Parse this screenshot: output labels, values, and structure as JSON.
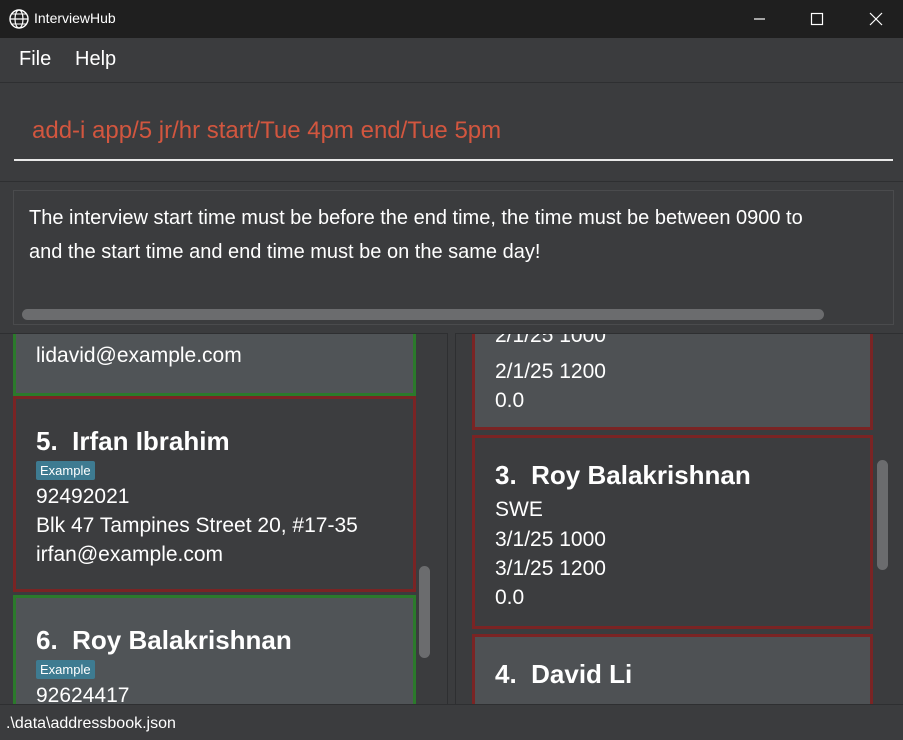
{
  "window": {
    "title": "InterviewHub",
    "icon": "globe-icon"
  },
  "menu": {
    "file": "File",
    "help": "Help"
  },
  "command": {
    "value": "add-i app/5 jr/hr start/Tue 4pm end/Tue 5pm",
    "color": "#d2563f"
  },
  "result": {
    "line1": "The interview start time must be before the end time, the time must be between 0900 to",
    "line2": "and the start time and end time must be on the same day!"
  },
  "applicants": [
    {
      "email": "lidavid@example.com"
    },
    {
      "index": "5.",
      "name": "Irfan Ibrahim",
      "tag": "Example",
      "phone": "92492021",
      "address": "Blk 47 Tampines Street 20, #17-35",
      "email": "irfan@example.com"
    },
    {
      "index": "6.",
      "name": "Roy Balakrishnan",
      "tag": "Example",
      "phone": "92624417"
    }
  ],
  "interviews": [
    {
      "start": "2/1/25 1000",
      "end": "2/1/25 1200",
      "rating": "0.0"
    },
    {
      "index": "3.",
      "name": "Roy Balakrishnan",
      "role": "SWE",
      "start": "3/1/25 1000",
      "end": "3/1/25 1200",
      "rating": "0.0"
    },
    {
      "index": "4.",
      "name": "David Li"
    }
  ],
  "status": {
    "path": ".\\data\\addressbook.json"
  },
  "colors": {
    "accent_border_red": "#7a2424",
    "accent_border_green": "#2b7a2b",
    "tag_bg": "#3e7b91"
  }
}
